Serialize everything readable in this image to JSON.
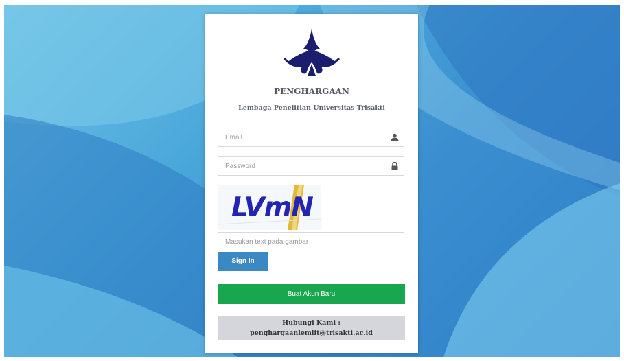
{
  "header": {
    "title": "PENGHARGAAN",
    "subtitle": "Lembaga Penelitian Universitas Trisakti"
  },
  "form": {
    "email_placeholder": "Email",
    "password_placeholder": "Password",
    "captcha_text": "LVmN",
    "captcha_placeholder": "Masukan text pada gambar",
    "signin_label": "Sign In",
    "create_account_label": "Buat Akun Baru"
  },
  "contact": {
    "label": "Hubungi Kami :",
    "email": "penghargaanlemlit@trisakti.ac.id"
  },
  "icons": {
    "email": "user-icon",
    "password": "lock-icon"
  },
  "colors": {
    "logo": "#1b1d6e",
    "signin_button": "#3a88c4",
    "create_button": "#18a64f",
    "contact_bg": "#d4d6dc",
    "captcha_text": "#2424b4"
  }
}
